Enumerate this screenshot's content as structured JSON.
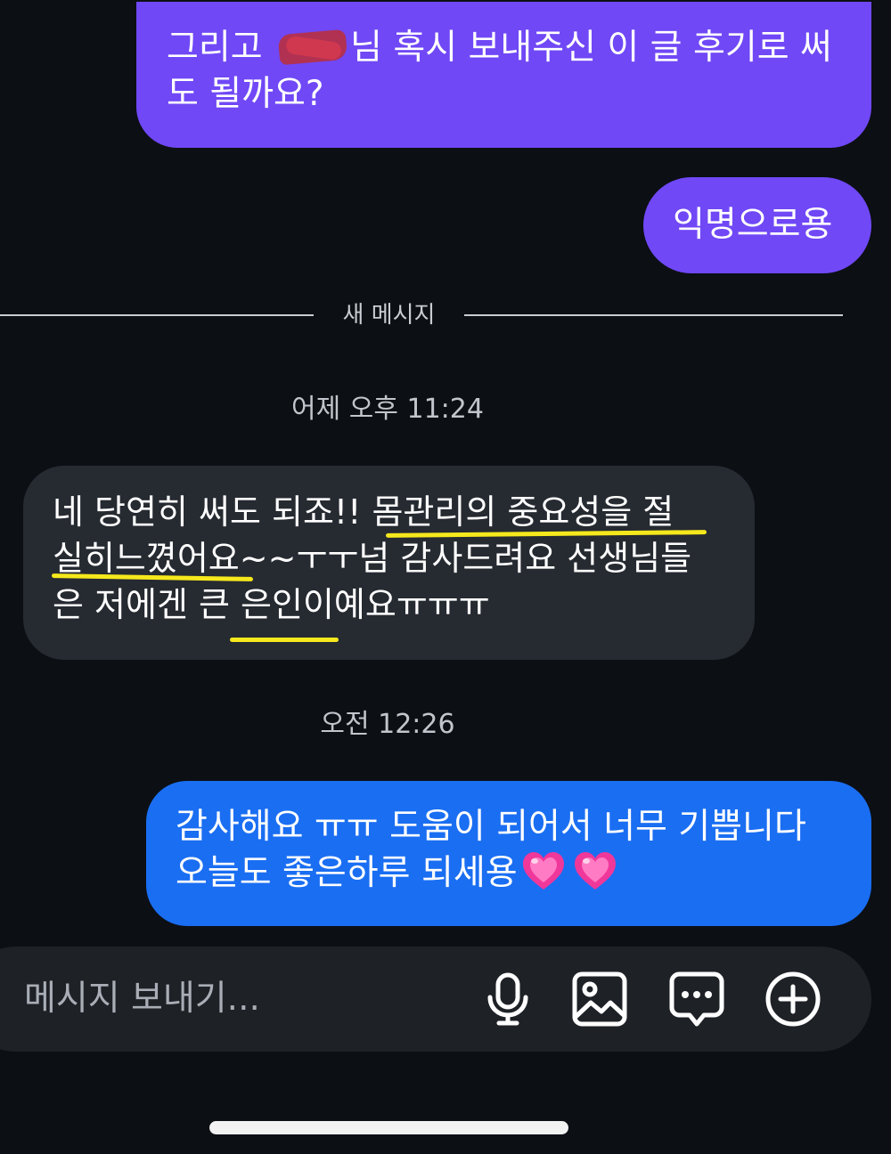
{
  "conversation": {
    "outgoing_message_1": {
      "line1_before": "그리고 ",
      "line1_after": "님 혹시 보내주신 이 글 후기로 써",
      "line2": "도 될까요?"
    },
    "outgoing_message_2": {
      "text": "익명으로용"
    },
    "divider_label": "새 메시지",
    "timestamp_1": "어제 오후 11:24",
    "incoming_message": {
      "line1": "네 당연히 써도 되죠!! 몸관리의 중요성을 절",
      "line2": "실히느꼈어요~~ㅜㅜ넘 감사드려요 선생님들",
      "line3": "은 저에겐 큰 은인이예요ㅠㅠㅠ"
    },
    "timestamp_2": "오전 12:26",
    "outgoing_message_3": {
      "line1": "감사해요 ㅠㅠ 도움이 되어서 너무 기쁩니다",
      "line2": "오늘도 좋은하루 되세용"
    }
  },
  "composer": {
    "placeholder": "메시지 보내기..."
  },
  "icons": {
    "mic": "microphone-icon",
    "gallery": "image-icon",
    "sticker": "chat-bubble-dots-icon",
    "plus": "plus-circle-icon",
    "heart": "growing-heart-emoji"
  },
  "colors": {
    "background": "#0c0f14",
    "outgoing_purple": "#7048f6",
    "outgoing_blue": "#1a6ef2",
    "incoming": "#262a31",
    "highlight": "#f5e81c",
    "composer": "#1e2227"
  }
}
